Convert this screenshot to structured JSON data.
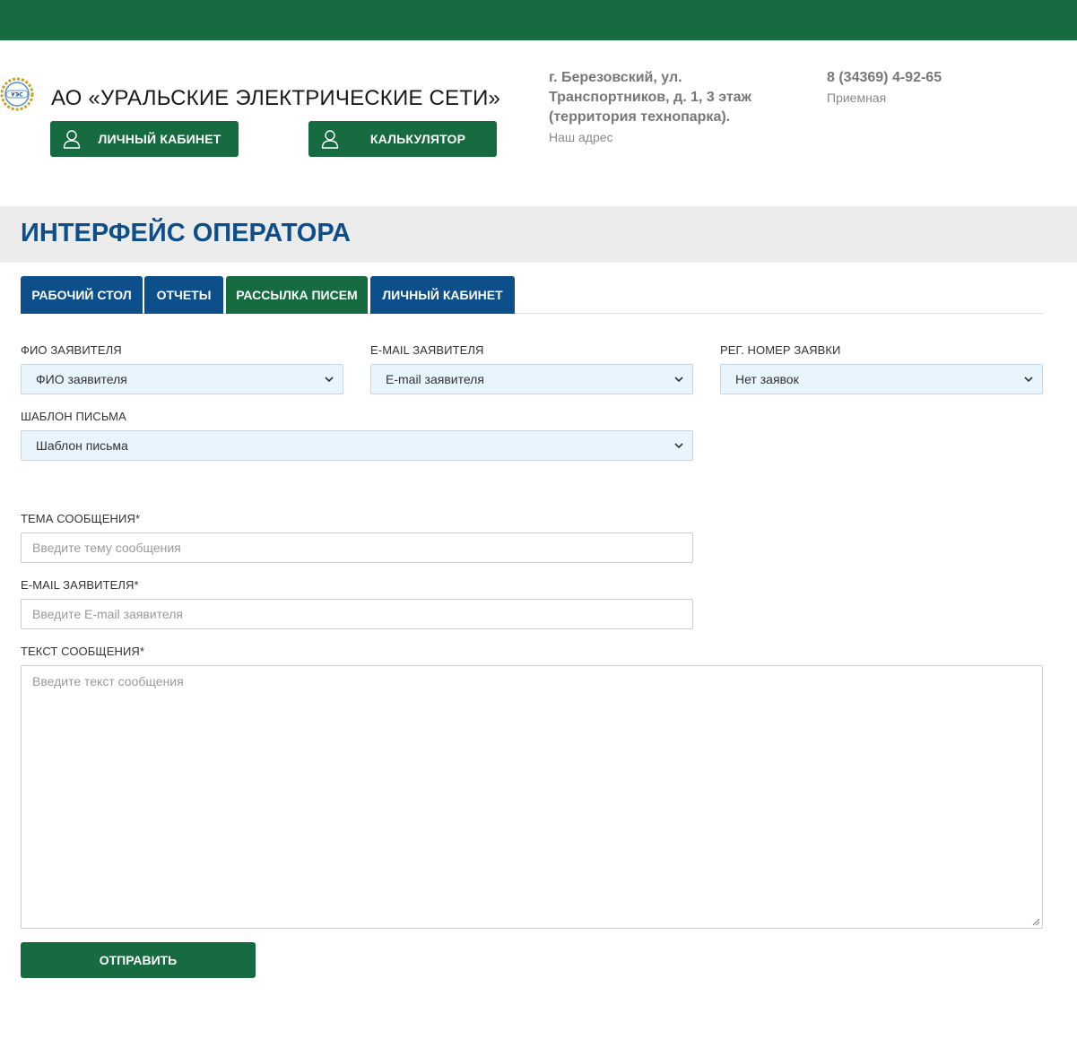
{
  "header": {
    "company_name": "АО «УРАЛЬСКИЕ ЭЛЕКТРИЧЕСКИЕ СЕТИ»",
    "logo_text": "УЭС",
    "buttons": {
      "cabinet": "ЛИЧНЫЙ КАБИНЕТ",
      "calculator": "КАЛЬКУЛЯТОР"
    },
    "address": {
      "line1": "г. Березовский, ул.",
      "line2": "Транспортников, д. 1, 3 этаж",
      "line3": "(территория технопарка).",
      "caption": "Наш адрес"
    },
    "phone": {
      "value": "8 (34369) 4-92-65",
      "caption": "Приемная"
    }
  },
  "page": {
    "title": "ИНТЕРФЕЙС ОПЕРАТОРА"
  },
  "tabs": [
    {
      "label": "РАБОЧИЙ СТОЛ",
      "active": false
    },
    {
      "label": "ОТЧЕТЫ",
      "active": false
    },
    {
      "label": "РАССЫЛКА ПИСЕМ",
      "active": true
    },
    {
      "label": "ЛИЧНЫЙ КАБИНЕТ",
      "active": false
    }
  ],
  "form": {
    "applicant_name": {
      "label": "ФИО заявителя",
      "selected": "ФИО заявителя"
    },
    "applicant_email_select": {
      "label": "E-mail заявителя",
      "selected": "E-mail заявителя"
    },
    "reg_number": {
      "label": "Рег. номер заявки",
      "selected": "Нет заявок"
    },
    "template": {
      "label": "Шаблон письма",
      "selected": "Шаблон письма"
    },
    "subject": {
      "label": "Тема сообщения*",
      "placeholder": "Введите тему сообщения"
    },
    "email": {
      "label": "E-mail заявителя*",
      "placeholder": "Введите E-mail заявителя"
    },
    "message": {
      "label": "Текст сообщения*",
      "placeholder": "Введите текст сообщения"
    },
    "submit_label": "ОТПРАВИТЬ"
  },
  "colors": {
    "brand_green": "#176b41",
    "brand_blue": "#0d4f8b",
    "select_bg": "#e8f4fe",
    "header_band": "#ececec"
  }
}
